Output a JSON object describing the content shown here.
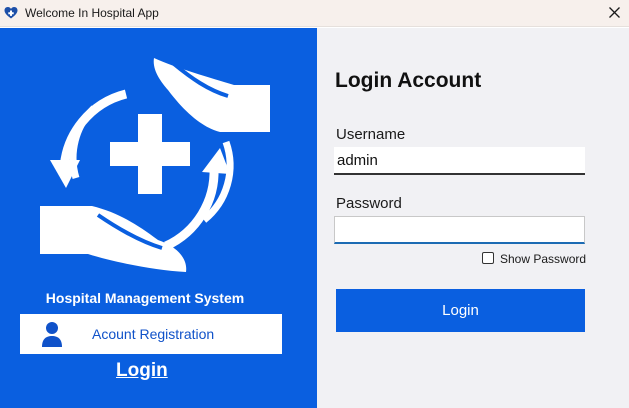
{
  "window": {
    "title": "Welcome In Hospital App",
    "icon": "heart-icon",
    "close_icon": "close-icon"
  },
  "left_panel": {
    "logo": "hospital-care-logo",
    "system_title": "Hospital Management System",
    "registration_button": {
      "label": "Acount Registration",
      "icon": "user-icon"
    },
    "login_link": "Login"
  },
  "login_form": {
    "title": "Login Account",
    "username": {
      "label": "Username",
      "value": "admin"
    },
    "password": {
      "label": "Password",
      "value": ""
    },
    "show_password": {
      "label": "Show Password",
      "checked": false
    },
    "login_button": "Login"
  },
  "colors": {
    "brand_blue": "#0a5fe0",
    "form_background": "#f1f1f4",
    "titlebar_background": "#f7f0ec"
  }
}
